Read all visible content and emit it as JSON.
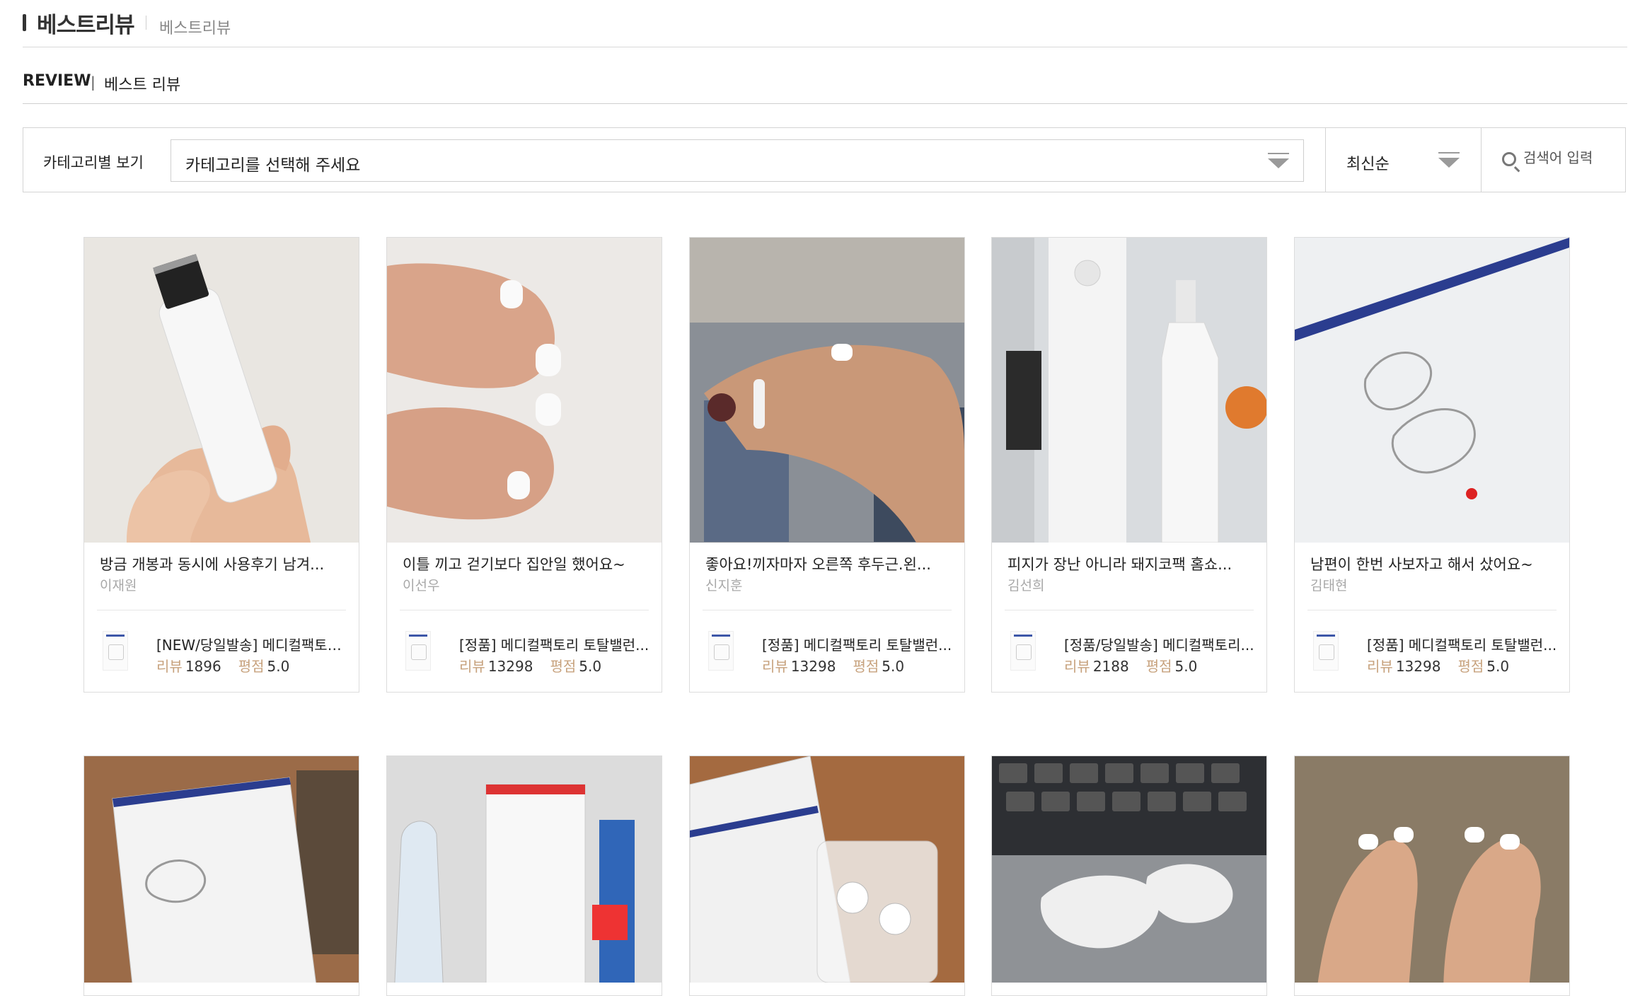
{
  "header": {
    "title": "베스트리뷰",
    "breadcrumb": "베스트리뷰"
  },
  "subnav": {
    "main": "REVIEW",
    "separator": "|",
    "sub": "베스트 리뷰"
  },
  "filters": {
    "category_label": "카테고리별 보기",
    "category_value": "카테고리를 선택해 주세요",
    "sort_value": "최신순",
    "search_placeholder": "검색어 입력"
  },
  "stat_labels": {
    "reviews": "리뷰",
    "rating": "평점"
  },
  "cards": [
    {
      "title": "방금 개봉과 동시에 사용후기 남겨...",
      "author": "이재원",
      "product": "[NEW/당일발송] 메디컬팩토리...",
      "reviews": "1896",
      "rating": "5.0",
      "photo": "hand-holding-skin-scrubber"
    },
    {
      "title": "이틀 끼고 걷기보다 집안일 했어요~",
      "author": "이선우",
      "product": "[정품] 메디컬팩토리 토탈밸런...",
      "reviews": "13298",
      "rating": "5.0",
      "photo": "feet-with-toe-separators"
    },
    {
      "title": "좋아요!끼자마자 오른쪽 후두근.왼...",
      "author": "신지훈",
      "product": "[정품] 메디컬팩토리 토탈밸런...",
      "reviews": "13298",
      "rating": "5.0",
      "photo": "foot-with-toe-ring-in-store"
    },
    {
      "title": "피지가 장난 아니라 돼지코팩 홈쇼...",
      "author": "김선희",
      "product": "[정품/당일발송] 메디컬팩토리...",
      "reviews": "2188",
      "rating": "5.0",
      "photo": "skincare-bottles"
    },
    {
      "title": "남편이 한번 사보자고 해서 샀어요~",
      "author": "김태현",
      "product": "[정품] 메디컬팩토리 토탈밸런...",
      "reviews": "13298",
      "rating": "5.0",
      "photo": "toe-straightener-box"
    }
  ],
  "cards_row2": [
    {
      "photo": "product-box-on-desk"
    },
    {
      "photo": "product-box-with-bottles"
    },
    {
      "photo": "toe-separator-package"
    },
    {
      "photo": "toe-separators-on-laptop"
    },
    {
      "photo": "feet-wearing-separators"
    }
  ]
}
